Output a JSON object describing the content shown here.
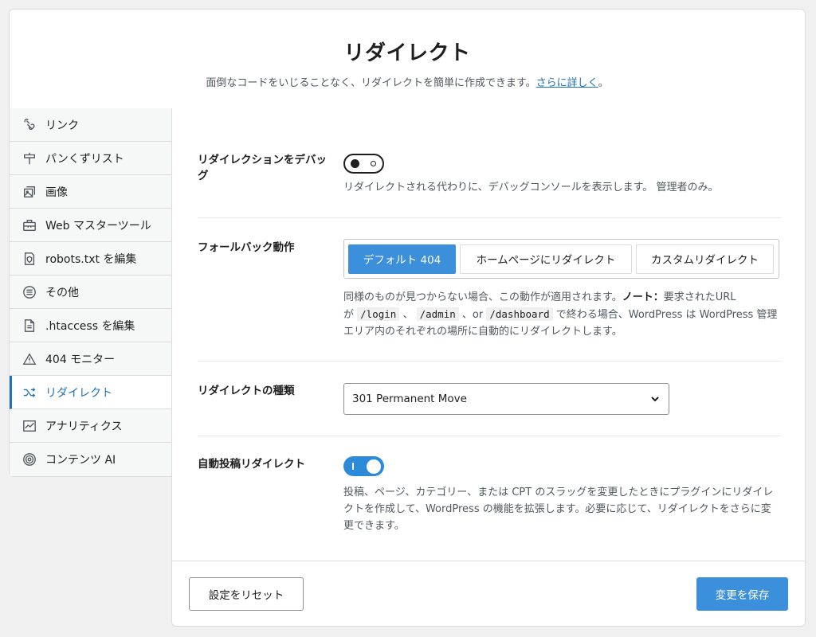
{
  "header": {
    "title": "リダイレクト",
    "subtitle": "面倒なコードをいじることなく、リダイレクトを簡単に作成できます。",
    "link": "さらに詳しく",
    "period": "。"
  },
  "sidebar": {
    "items": [
      {
        "label": "リンク",
        "icon": "link-icon"
      },
      {
        "label": "パンくずリスト",
        "icon": "signpost-icon"
      },
      {
        "label": "画像",
        "icon": "image-icon"
      },
      {
        "label": "Web マスターツール",
        "icon": "toolbox-icon"
      },
      {
        "label": "robots.txt を編集",
        "icon": "shield-file-icon"
      },
      {
        "label": "その他",
        "icon": "list-circle-icon"
      },
      {
        "label": ".htaccess を編集",
        "icon": "file-icon"
      },
      {
        "label": "404 モニター",
        "icon": "warning-icon"
      },
      {
        "label": "リダイレクト",
        "icon": "shuffle-icon",
        "active": true
      },
      {
        "label": "アナリティクス",
        "icon": "chart-icon"
      },
      {
        "label": "コンテンツ AI",
        "icon": "ai-icon"
      }
    ]
  },
  "debug": {
    "label": "リダイレクションをデバッグ",
    "state": "off",
    "description": "リダイレクトされる代わりに、デバッグコンソールを表示します。 管理者のみ。"
  },
  "fallback": {
    "label": "フォールバック動作",
    "options": [
      "デフォルト 404",
      "ホームページにリダイレクト",
      "カスタムリダイレクト"
    ],
    "selected": "デフォルト 404",
    "desc_1": "同様のものが見つからない場合、この動作が適用されます。",
    "note_label": "ノート：",
    "desc_2": "要求されたURL",
    "desc_3": "が",
    "code_1": "/login",
    "sep_1": "、",
    "code_2": "/admin",
    "sep_2": "、or",
    "code_3": "/dashboard",
    "desc_4": "で終わる場合、WordPress は WordPress 管理エリア内のそれぞれの場所に自動的にリダイレクトします。"
  },
  "redirect_type": {
    "label": "リダイレクトの種類",
    "value": "301 Permanent Move"
  },
  "auto_post": {
    "label": "自動投稿リダイレクト",
    "state": "on",
    "description": "投稿、ページ、カテゴリー、または CPT のスラッグを変更したときにプラグインにリダイレクトを作成して、WordPress の機能を拡張します。必要に応じて、リダイレクトをさらに変更できます。"
  },
  "footer": {
    "reset_label": "設定をリセット",
    "save_label": "変更を保存"
  }
}
